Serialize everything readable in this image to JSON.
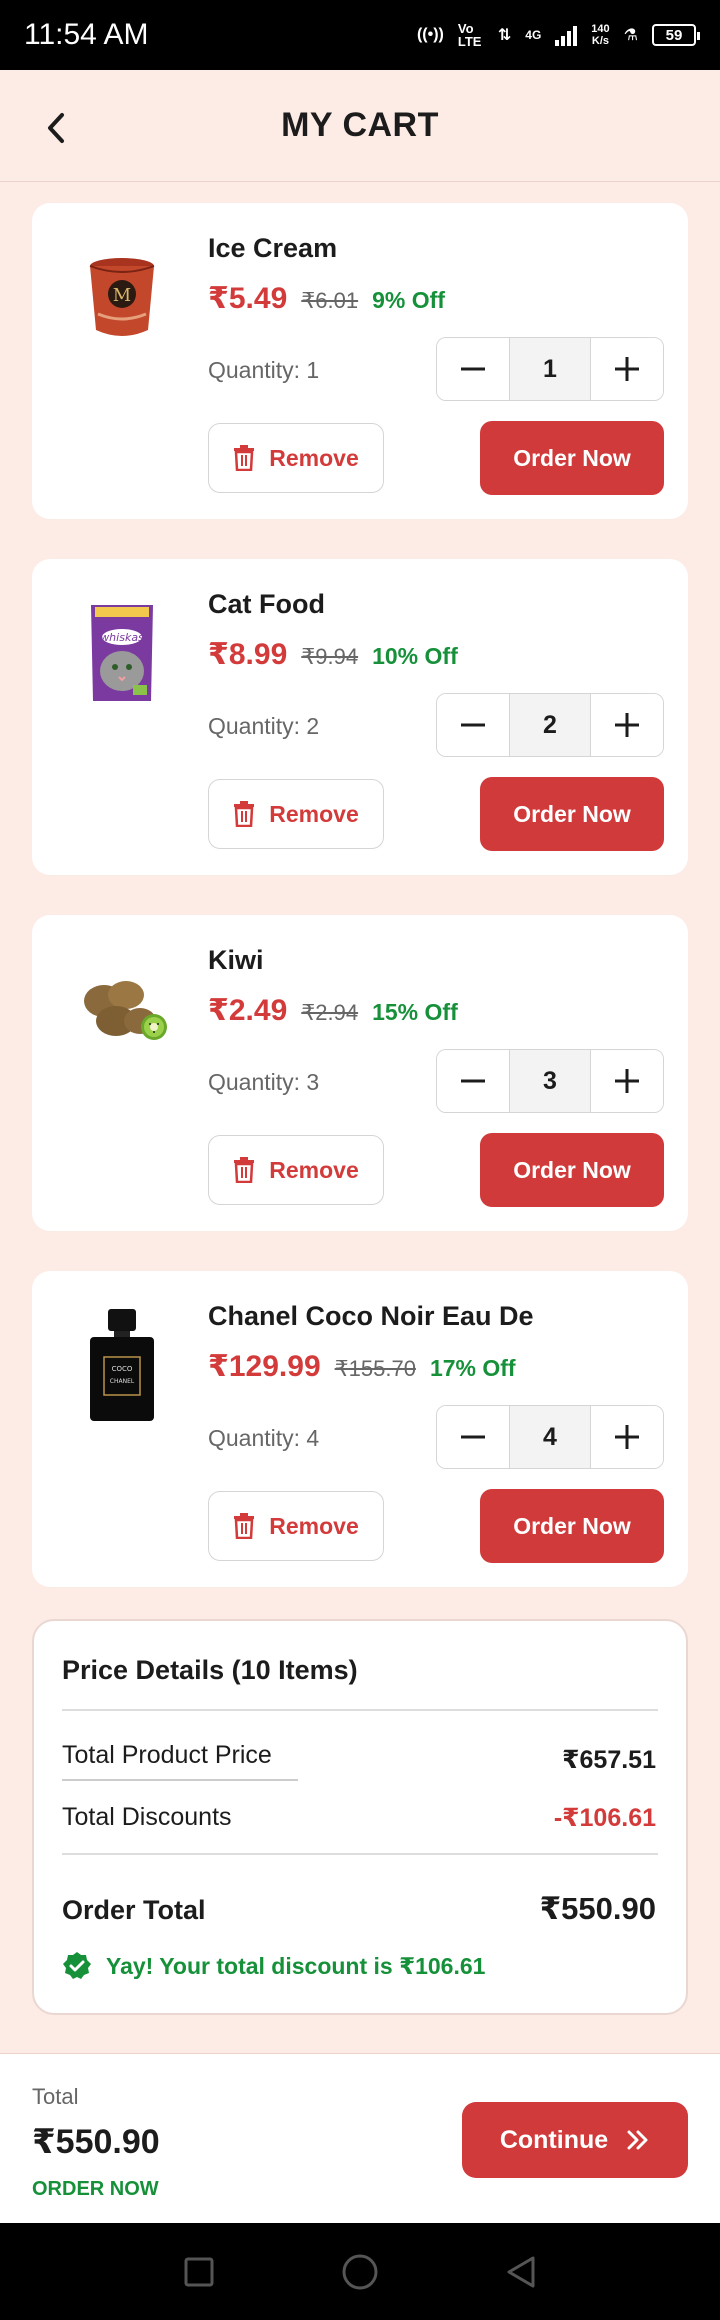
{
  "status_bar": {
    "time": "11:54 AM",
    "net_speed_top": "140",
    "net_speed_bottom": "K/s",
    "network": "4G",
    "volte": "Vo LTE",
    "battery": "59"
  },
  "header": {
    "title": "MY CART",
    "back_icon": "chevron-left-icon"
  },
  "cart_items": [
    {
      "name": "Ice Cream",
      "price": "₹5.49",
      "mrp": "₹6.01",
      "discount": "9% Off",
      "quantity_label": "Quantity: 1",
      "quantity": "1",
      "remove_label": "Remove",
      "order_label": "Order Now",
      "image_icon": "ice-cream-tub-image"
    },
    {
      "name": "Cat Food",
      "price": "₹8.99",
      "mrp": "₹9.94",
      "discount": "10% Off",
      "quantity_label": "Quantity: 2",
      "quantity": "2",
      "remove_label": "Remove",
      "order_label": "Order Now",
      "image_icon": "cat-food-pouch-image"
    },
    {
      "name": "Kiwi",
      "price": "₹2.49",
      "mrp": "₹2.94",
      "discount": "15% Off",
      "quantity_label": "Quantity: 3",
      "quantity": "3",
      "remove_label": "Remove",
      "order_label": "Order Now",
      "image_icon": "kiwi-fruit-image"
    },
    {
      "name": "Chanel Coco Noir Eau De",
      "price": "₹129.99",
      "mrp": "₹155.70",
      "discount": "17% Off",
      "quantity_label": "Quantity: 4",
      "quantity": "4",
      "remove_label": "Remove",
      "order_label": "Order Now",
      "image_icon": "perfume-bottle-image",
      "image_text": "COCO CHANEL"
    }
  ],
  "price_details": {
    "title": "Price Details (10 Items)",
    "total_product_label": "Total Product Price",
    "total_product_value": "₹657.51",
    "total_discount_label": "Total Discounts",
    "total_discount_value": "-₹106.61",
    "order_total_label": "Order Total",
    "order_total_value": "₹550.90",
    "discount_note": "Yay! Your total discount is ₹106.61"
  },
  "bottom_bar": {
    "label": "Total",
    "total": "₹550.90",
    "order_now": "ORDER NOW",
    "continue_label": "Continue"
  },
  "colors": {
    "accent": "#d13a3a",
    "price_red": "#d33b3b",
    "discount_green": "#16913a",
    "page_bg": "#fdebe5"
  }
}
